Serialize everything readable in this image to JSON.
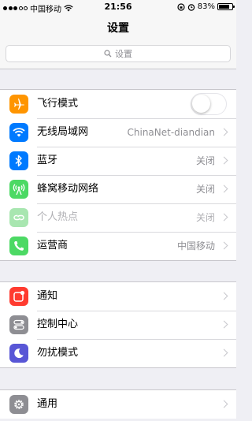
{
  "status_bar": {
    "carrier": "中国移动",
    "time": "21:56",
    "battery_percent": "83%",
    "signal_bars": 3,
    "battery_level": 0.83
  },
  "nav": {
    "title": "设置"
  },
  "search": {
    "placeholder": "设置"
  },
  "groups": {
    "network": [
      {
        "label": "飞行模式",
        "icon": "airplane-icon",
        "color": "#ff9500",
        "toggle": false
      },
      {
        "label": "无线局域网",
        "icon": "wifi-icon",
        "color": "#007aff",
        "value": "ChinaNet-diandian"
      },
      {
        "label": "蓝牙",
        "icon": "bluetooth-icon",
        "color": "#007aff",
        "value": "关闭"
      },
      {
        "label": "蜂窝移动网络",
        "icon": "cellular-icon",
        "color": "#4cd964",
        "value": "关闭"
      },
      {
        "label": "个人热点",
        "icon": "hotspot-icon",
        "color": "#a8e6b0",
        "value": "关闭",
        "disabled": true
      },
      {
        "label": "运营商",
        "icon": "phone-icon",
        "color": "#4cd964",
        "value": "中国移动"
      }
    ],
    "notifications": [
      {
        "label": "通知",
        "icon": "notifications-icon",
        "color": "#ff3b30"
      },
      {
        "label": "控制中心",
        "icon": "control-center-icon",
        "color": "#8e8e93"
      },
      {
        "label": "勿扰模式",
        "icon": "moon-icon",
        "color": "#5856d6"
      }
    ],
    "general": [
      {
        "label": "通用",
        "icon": "gear-icon",
        "color": "#8e8e93"
      }
    ]
  }
}
